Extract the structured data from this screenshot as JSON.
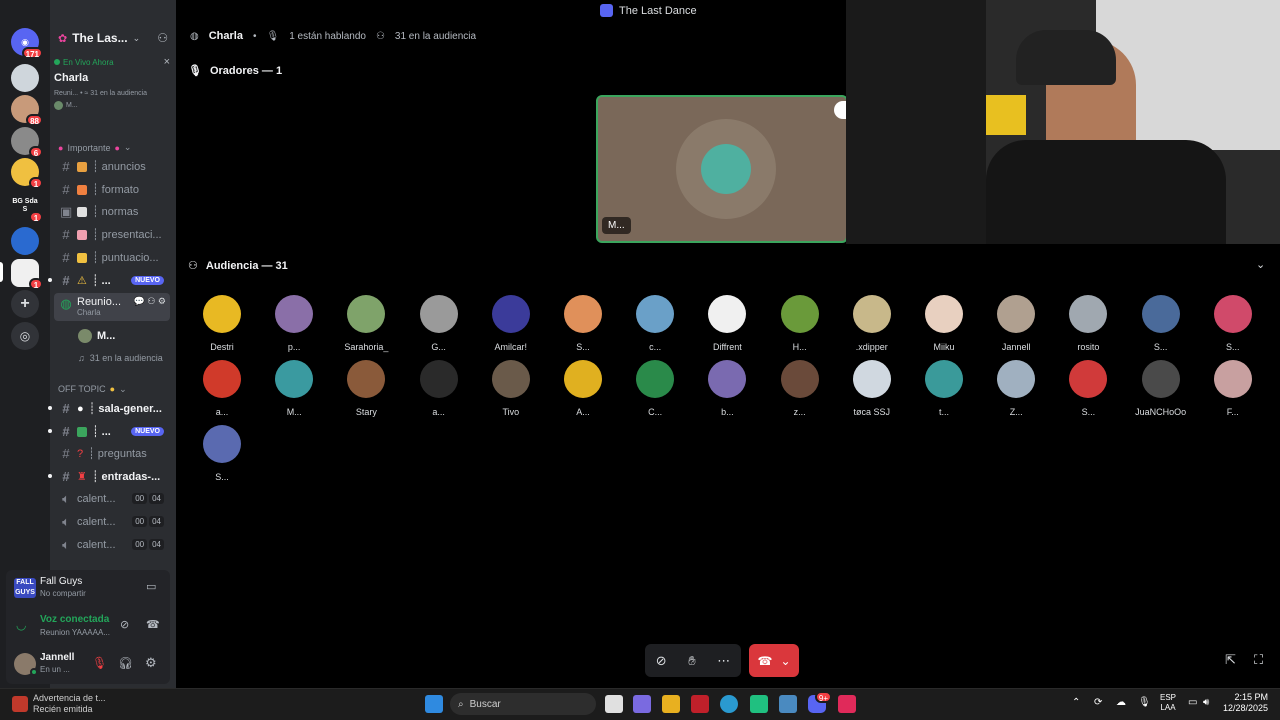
{
  "window": {
    "title": "The Last Dance"
  },
  "rail": {
    "items": [
      {
        "name": "home",
        "badge": "171"
      },
      {
        "name": "server-2",
        "badge": ""
      },
      {
        "name": "server-3",
        "badge": "88"
      },
      {
        "name": "server-4",
        "badge": "6"
      },
      {
        "name": "server-5",
        "badge": "1"
      },
      {
        "name": "server-6",
        "label": "BG Sda S",
        "badge": "1"
      },
      {
        "name": "server-7",
        "badge": ""
      },
      {
        "name": "server-8",
        "badge": "1"
      }
    ]
  },
  "server": {
    "name": "The Las..."
  },
  "live": {
    "label": "En Vivo Ahora",
    "title": "Charla",
    "sub": "Reuni... • ≈ 31 en la audiencia",
    "user": "M..."
  },
  "categories": {
    "importante": "Importante",
    "offtopic": "OFF TOPIC"
  },
  "channels": [
    {
      "name": "┊ anuncios"
    },
    {
      "name": "┊ formato"
    },
    {
      "name": "┊ normas"
    },
    {
      "name": "┊ presentaci..."
    },
    {
      "name": "┊ puntuacio..."
    },
    {
      "name": "┊ ...",
      "tag": "NUEVO"
    },
    {
      "name": "Reunio...",
      "sub": "Charla"
    },
    {
      "name": "M..."
    },
    {
      "name": "31 en la audiencia"
    },
    {
      "name": "┊ sala-gener..."
    },
    {
      "name": "┊ ...",
      "tag": "NUEVO"
    },
    {
      "name": "┊ preguntas"
    },
    {
      "name": "┊ entradas-..."
    },
    {
      "name": "calent...",
      "c1": "00",
      "c2": "04"
    },
    {
      "name": "calent...",
      "c1": "00",
      "c2": "04"
    },
    {
      "name": "calent...",
      "c1": "00",
      "c2": "04"
    }
  ],
  "activity": {
    "game": "Fall Guys",
    "status": "No compartir"
  },
  "voice": {
    "status": "Voz conectada",
    "channel": "Reunion YAAAAA..."
  },
  "user": {
    "name": "Jannell",
    "status": "En un ..."
  },
  "header": {
    "channel": "Charla",
    "speaking": "1 están hablando",
    "audience": "31 en la audiencia"
  },
  "speakers": {
    "title": "Oradores — 1",
    "tile_name": "M..."
  },
  "audience": {
    "title": "Audiencia — 31",
    "members": [
      {
        "name": "Destri",
        "color": "#e8b923"
      },
      {
        "name": "p...",
        "color": "#8a6fa8"
      },
      {
        "name": "Sarahoria_",
        "color": "#7fa36a"
      },
      {
        "name": "G...",
        "color": "#9a9a9a"
      },
      {
        "name": "Amilcar!",
        "color": "#3b3b9a"
      },
      {
        "name": "S...",
        "color": "#e0905a"
      },
      {
        "name": "c...",
        "color": "#6aa0c8"
      },
      {
        "name": "Diffrent",
        "color": "#f0f0f0"
      },
      {
        "name": "H...",
        "color": "#6a9a3a"
      },
      {
        "name": ".xdipper",
        "color": "#c8b88a"
      },
      {
        "name": "Miiku",
        "color": "#e8d0c0"
      },
      {
        "name": "Jannell",
        "color": "#b0a090"
      },
      {
        "name": "rosito",
        "color": "#a0a8b0"
      },
      {
        "name": "S...",
        "color": "#4a6a9a"
      },
      {
        "name": "S...",
        "color": "#d04a6a"
      },
      {
        "name": "a...",
        "color": "#d03a2a"
      },
      {
        "name": "M...",
        "color": "#3a9aa0"
      },
      {
        "name": "Stary",
        "color": "#8a5a3a"
      },
      {
        "name": "a...",
        "color": "#2a2a2a"
      },
      {
        "name": "Tivo",
        "color": "#6a5a4a"
      },
      {
        "name": "A...",
        "color": "#e0b020"
      },
      {
        "name": "C...",
        "color": "#2a8a4a"
      },
      {
        "name": "b...",
        "color": "#7a6ab0"
      },
      {
        "name": "z...",
        "color": "#6a4a3a"
      },
      {
        "name": "tøca SSJ",
        "color": "#d0d8e0"
      },
      {
        "name": "t...",
        "color": "#3a9a9a"
      },
      {
        "name": "Z...",
        "color": "#a0b0c0"
      },
      {
        "name": "S...",
        "color": "#d03a3a"
      },
      {
        "name": "JuaNCHoOo",
        "color": "#4a4a4a"
      },
      {
        "name": "F...",
        "color": "#c8a0a0"
      },
      {
        "name": "S...",
        "color": "#5a6ab0"
      }
    ]
  },
  "taskbar": {
    "notif_title": "Advertencia de t...",
    "notif_sub": "Recién emitida",
    "search": "Buscar",
    "lang1": "ESP",
    "lang2": "LAA",
    "time": "2:15 PM",
    "date": "12/28/2025",
    "discord_badge": "9+"
  }
}
